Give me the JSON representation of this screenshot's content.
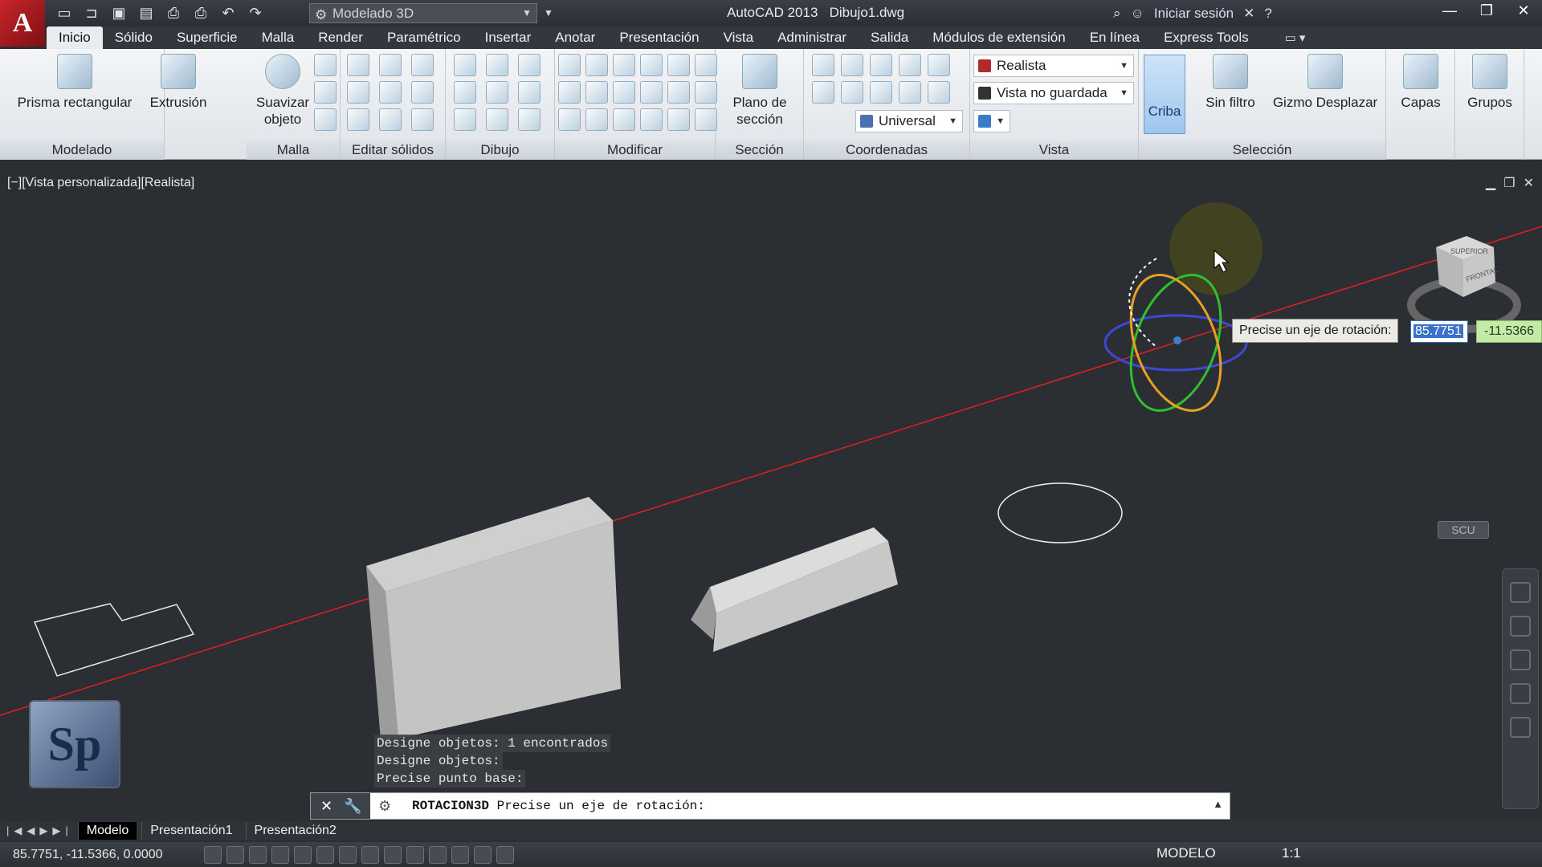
{
  "titlebar": {
    "workspace": "Modelado 3D",
    "app_title": "AutoCAD 2013",
    "file_name": "Dibujo1.dwg",
    "signin": "Iniciar sesión"
  },
  "tabs": [
    "Inicio",
    "Sólido",
    "Superficie",
    "Malla",
    "Render",
    "Paramétrico",
    "Insertar",
    "Anotar",
    "Presentación",
    "Vista",
    "Administrar",
    "Salida",
    "Módulos de extensión",
    "En línea",
    "Express Tools"
  ],
  "ribbon": {
    "modelado": {
      "title": "Modelado",
      "prisma": "Prisma rectangular",
      "extrusion": "Extrusión"
    },
    "malla": {
      "title": "Malla",
      "suavizar": "Suavizar objeto"
    },
    "editar_solidos": {
      "title": "Editar sólidos"
    },
    "dibujo": {
      "title": "Dibujo"
    },
    "modificar": {
      "title": "Modificar"
    },
    "seccion": {
      "title": "Sección",
      "plano": "Plano de sección"
    },
    "coordenadas": {
      "title": "Coordenadas",
      "universal": "Universal"
    },
    "vista": {
      "title": "Vista",
      "visual_style": "Realista",
      "saved_view": "Vista no guardada"
    },
    "seleccion": {
      "title": "Selección",
      "criba": "Criba",
      "sin_filtro": "Sin filtro",
      "gizmo": "Gizmo Desplazar"
    },
    "capas": "Capas",
    "grupos": "Grupos"
  },
  "viewport": {
    "label": "[−][Vista personalizada][Realista]",
    "viewcube_top": "SUPERIOR",
    "viewcube_front": "FRONTAL",
    "scu": "SCU",
    "prompt": "Precise un eje de rotación:",
    "input_x": "85.7751",
    "input_y": "-11.5366"
  },
  "command": {
    "history": [
      "Designe objetos: 1 encontrados",
      "Designe objetos:",
      "Precise punto base:"
    ],
    "name": "ROTACION3D",
    "prompt": "Precise un eje de rotación:"
  },
  "layout_tabs": [
    "Modelo",
    "Presentación1",
    "Presentación2"
  ],
  "status": {
    "coords": "85.7751, -11.5366, 0.0000",
    "space": "MODELO",
    "scale": "1:1"
  },
  "watermark": "Sp",
  "colors": {
    "axis_line": "#e02020",
    "gizmo_x": "#d63a3a",
    "gizmo_y": "#2fbf2f",
    "gizmo_z": "#3f47d8",
    "gizmo_orange": "#e8a020"
  }
}
